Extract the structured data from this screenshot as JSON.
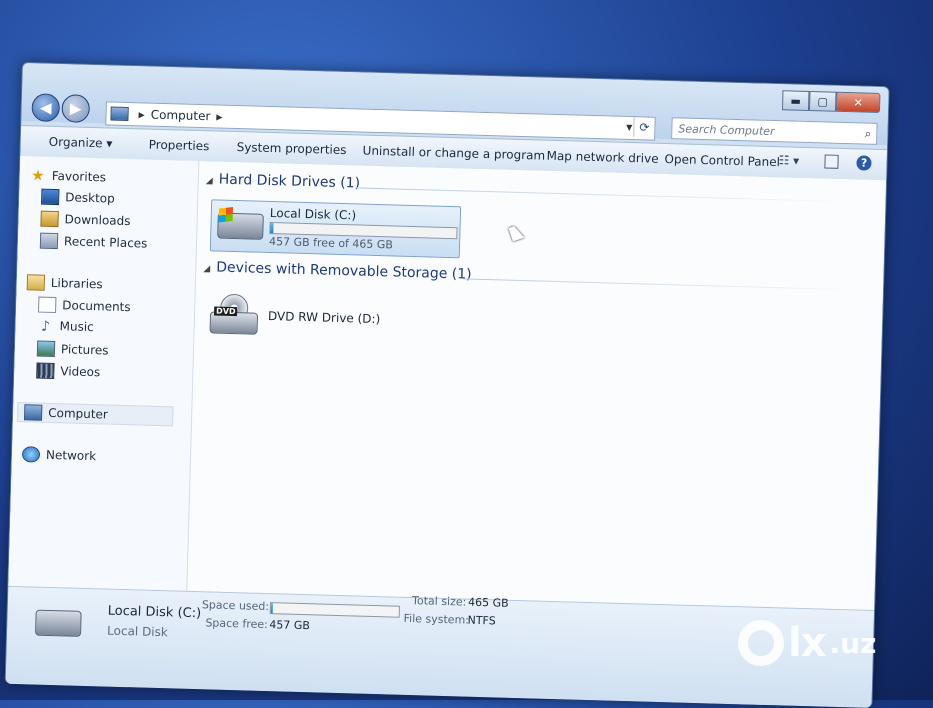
{
  "window": {
    "buttons": {
      "minimize": "▬",
      "maximize": "▢",
      "close": "✕"
    }
  },
  "address": {
    "location": "Computer"
  },
  "search": {
    "placeholder": "Search Computer"
  },
  "toolbar": {
    "organize": "Organize ▾",
    "properties": "Properties",
    "system_properties": "System properties",
    "uninstall": "Uninstall or change a program",
    "map_network": "Map network drive",
    "control_panel": "Open Control Panel"
  },
  "sidebar": {
    "favorites": "Favorites",
    "desktop": "Desktop",
    "downloads": "Downloads",
    "recent_places": "Recent Places",
    "libraries": "Libraries",
    "documents": "Documents",
    "music": "Music",
    "pictures": "Pictures",
    "videos": "Videos",
    "computer": "Computer",
    "network": "Network"
  },
  "groups": {
    "hard_disks": "Hard Disk Drives (1)",
    "removable": "Devices with Removable Storage (1)"
  },
  "local_disk": {
    "name": "Local Disk (C:)",
    "free_text": "457 GB free of 465 GB",
    "used_fraction": 0.017
  },
  "dvd": {
    "name": "DVD RW Drive (D:)",
    "badge": "DVD"
  },
  "details": {
    "title": "Local Disk (C:)",
    "subtitle": "Local Disk",
    "space_used_label": "Space used:",
    "space_free_label": "Space free:",
    "space_free_value": "457 GB",
    "total_size_label": "Total size:",
    "total_size_value": "465 GB",
    "file_system_label": "File system:",
    "file_system_value": "NTFS"
  },
  "watermark": {
    "brand": "lx",
    "tld": ".uz"
  },
  "colors": {
    "accent": "#1e3a78",
    "capacity_bar": "#1b83c8"
  }
}
